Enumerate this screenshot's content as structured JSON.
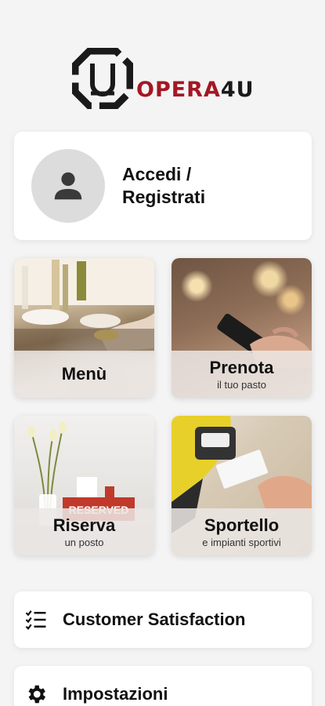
{
  "app": {
    "logo": {
      "text_brand": "OPER",
      "text_a": "A",
      "text_suffix": "4U",
      "accent": "#a41724"
    }
  },
  "login": {
    "label": "Accedi /\nRegistrati",
    "icon": "person-icon"
  },
  "tiles": [
    {
      "title": "Menù",
      "subtitle": ""
    },
    {
      "title": "Prenota",
      "subtitle": "il tuo pasto"
    },
    {
      "title": "Riserva",
      "subtitle": "un posto"
    },
    {
      "title": "Sportello",
      "subtitle": "e impianti sportivi"
    }
  ],
  "reserved_sign": "RESERVED",
  "menu": [
    {
      "label": "Customer Satisfaction",
      "icon": "checklist-icon"
    },
    {
      "label": "Impostazioni",
      "icon": "gear-icon"
    }
  ],
  "colors": {
    "background": "#f4f4f4",
    "card": "#ffffff",
    "brand_red": "#a41724"
  }
}
